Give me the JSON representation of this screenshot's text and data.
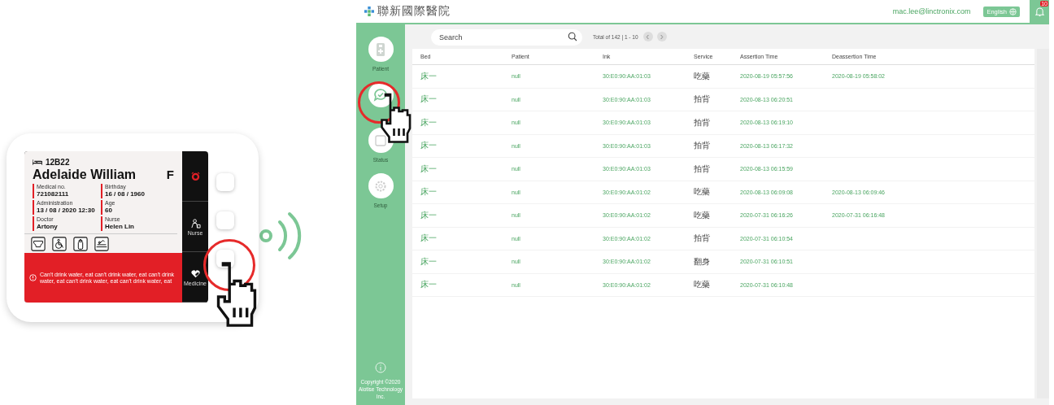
{
  "device": {
    "bed": "12B22",
    "name": "Adelaide William",
    "sex": "F",
    "fields": [
      {
        "label": "Medical no.",
        "value": "721082111"
      },
      {
        "label": "Birthday",
        "value": "16 / 08 / 1960"
      },
      {
        "label": "Administration",
        "value": "13 / 08 / 2020  12:30"
      },
      {
        "label": "Age",
        "value": "60"
      },
      {
        "label": "Doctor",
        "value": "Artony"
      },
      {
        "label": "Nurse",
        "value": "Helen Lin"
      }
    ],
    "care_icons": [
      {
        "kind": "diaper"
      },
      {
        "kind": "wheelchair"
      },
      {
        "kind": "bottle"
      },
      {
        "kind": "bed"
      }
    ],
    "alert": "Can't drink water, eat can't drink water, eat can't drink water, eat can't drink water, eat can't drink water, eat",
    "side_buttons": [
      {
        "kind": "alarm"
      },
      {
        "kind": "nurse",
        "label": "Nurse"
      },
      {
        "kind": "medicine",
        "label": "Medicine"
      }
    ]
  },
  "app": {
    "header": {
      "logo_text": "聯新國際醫院",
      "user": "mac.lee@linctronix.com",
      "language": "English",
      "notification_count": "10"
    },
    "sidebar": {
      "items": [
        {
          "kind": "patient",
          "label": "Patient"
        },
        {
          "kind": "event"
        },
        {
          "kind": "status",
          "label": "Status"
        },
        {
          "kind": "setup",
          "label": "Setup"
        }
      ],
      "copyright": "Copyright ©2020 Aiotise Technology Inc."
    },
    "search": {
      "placeholder": "Search"
    },
    "pagination": "Total of 142 | 1 - 10",
    "table": {
      "columns": [
        "Bed",
        "Patient",
        "Ink",
        "Service",
        "Assertion Time",
        "Deassertion Time"
      ],
      "rows": [
        [
          "床一",
          "null",
          "30:E0:90:AA:01:03",
          "吃藥",
          "2020-08-19 05:57:56",
          "2020-08-19 05:58:02"
        ],
        [
          "床一",
          "null",
          "30:E0:90:AA:01:03",
          "拍背",
          "2020-08-13 06:20:51"
        ],
        [
          "床一",
          "null",
          "30:E0:90:AA:01:03",
          "拍背",
          "2020-08-13 06:19:10"
        ],
        [
          "床一",
          "null",
          "30:E0:90:AA:01:03",
          "拍背",
          "2020-08-13 06:17:32"
        ],
        [
          "床一",
          "null",
          "30:E0:90:AA:01:03",
          "拍背",
          "2020-08-13 06:15:59"
        ],
        [
          "床一",
          "null",
          "30:E0:90:AA:01:02",
          "吃藥",
          "2020-08-13 06:09:08",
          "2020-08-13 06:09:46"
        ],
        [
          "床一",
          "null",
          "30:E0:90:AA:01:02",
          "吃藥",
          "2020-07-31 06:16:26",
          "2020-07-31 06:16:48"
        ],
        [
          "床一",
          "null",
          "30:E0:90:AA:01:02",
          "拍背",
          "2020-07-31 06:10:54"
        ],
        [
          "床一",
          "null",
          "30:E0:90:AA:01:02",
          "翻身",
          "2020-07-31 06:10:51"
        ],
        [
          "床一",
          "null",
          "30:E0:90:AA:01:02",
          "吃藥",
          "2020-07-31 06:10:48"
        ]
      ]
    }
  }
}
